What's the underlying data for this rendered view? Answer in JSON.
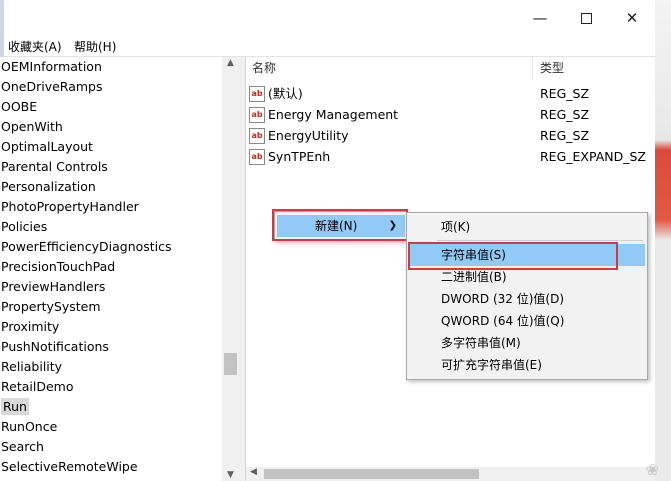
{
  "menubar": {
    "favorites": "收藏夹(A)",
    "help": "帮助(H)"
  },
  "caption": {
    "minimize_icon": "minimize-icon",
    "maximize_icon": "maximize-icon",
    "close_icon": "close-icon"
  },
  "tree": {
    "items": [
      "OEMInformation",
      "OneDriveRamps",
      "OOBE",
      "OpenWith",
      "OptimalLayout",
      "Parental Controls",
      "Personalization",
      "PhotoPropertyHandler",
      "Policies",
      "PowerEfficiencyDiagnostics",
      "PrecisionTouchPad",
      "PreviewHandlers",
      "PropertySystem",
      "Proximity",
      "PushNotifications",
      "Reliability",
      "RetailDemo",
      "Run",
      "RunOnce",
      "Search",
      "SelectiveRemoteWipe"
    ],
    "selected": "Run"
  },
  "list": {
    "columns": {
      "name": "名称",
      "type": "类型"
    },
    "rows": [
      {
        "name": "(默认)",
        "type": "REG_SZ",
        "icon": "ab-string-icon"
      },
      {
        "name": "Energy Management",
        "type": "REG_SZ",
        "icon": "ab-string-icon"
      },
      {
        "name": "EnergyUtility",
        "type": "REG_SZ",
        "icon": "ab-string-icon"
      },
      {
        "name": "SynTPEnh",
        "type": "REG_EXPAND_SZ",
        "icon": "ab-string-icon"
      }
    ]
  },
  "context_menu": {
    "new_label": "新建(N)",
    "submenu": [
      "项(K)",
      "字符串值(S)",
      "二进制值(B)",
      "DWORD (32 位)值(D)",
      "QWORD (64 位)值(Q)",
      "多字符串值(M)",
      "可扩充字符串值(E)"
    ],
    "highlighted": "字符串值(S)"
  },
  "colors": {
    "highlight": "#91c9f7",
    "annotation_red": "#d8373c"
  }
}
